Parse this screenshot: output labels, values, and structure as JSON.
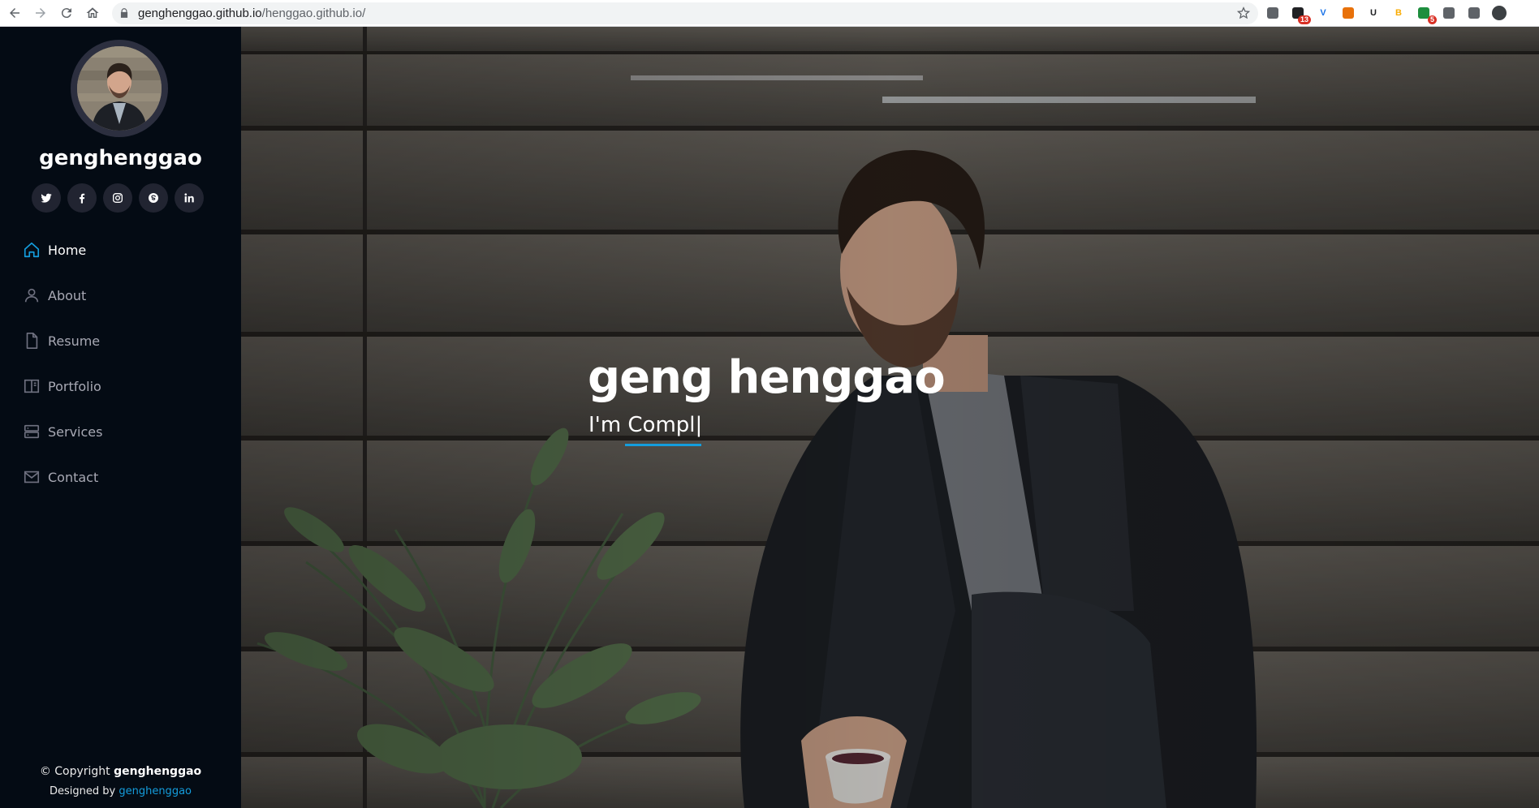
{
  "browser": {
    "url_host": "genghenggao.github.io",
    "url_path": "/henggao.github.io/",
    "extensions": [
      {
        "icon": "chart-extension-icon",
        "label": "",
        "color": "#5f6368"
      },
      {
        "icon": "calendar-extension-icon",
        "label": "",
        "color": "#202124",
        "badge": "13"
      },
      {
        "icon": "v-extension-icon",
        "label": "V",
        "color": "#1a73e8"
      },
      {
        "icon": "firefox-like-extension-icon",
        "label": "",
        "color": "#e8710a"
      },
      {
        "icon": "u-extension-icon",
        "label": "U",
        "color": "#202124"
      },
      {
        "icon": "b-extension-icon",
        "label": "B",
        "color": "#f9ab00"
      },
      {
        "icon": "bug-extension-icon",
        "label": "",
        "color": "#1e8e3e",
        "badge": "5"
      },
      {
        "icon": "puzzle-extension-icon",
        "label": "",
        "color": "#5f6368"
      },
      {
        "icon": "reading-list-icon",
        "label": "",
        "color": "#5f6368"
      },
      {
        "icon": "profile-avatar-icon",
        "label": "",
        "color": "#3c4043"
      }
    ]
  },
  "sidebar": {
    "name": "genghenggao",
    "socials": [
      {
        "icon": "twitter-icon"
      },
      {
        "icon": "facebook-icon"
      },
      {
        "icon": "instagram-icon"
      },
      {
        "icon": "skype-icon"
      },
      {
        "icon": "linkedin-icon"
      }
    ],
    "menu": [
      {
        "label": "Home",
        "icon": "home-icon",
        "active": true
      },
      {
        "label": "About",
        "icon": "user-icon",
        "active": false
      },
      {
        "label": "Resume",
        "icon": "file-icon",
        "active": false
      },
      {
        "label": "Portfolio",
        "icon": "book-icon",
        "active": false
      },
      {
        "label": "Services",
        "icon": "server-icon",
        "active": false
      },
      {
        "label": "Contact",
        "icon": "envelope-icon",
        "active": false
      }
    ],
    "copyright_prefix": "© Copyright",
    "copyright_name": "genghenggao",
    "credits_prefix": "Designed by",
    "credits_name": "genghenggao"
  },
  "hero": {
    "title": "geng henggao",
    "subtitle": "I'm Compl",
    "accent": "#149ddd"
  }
}
